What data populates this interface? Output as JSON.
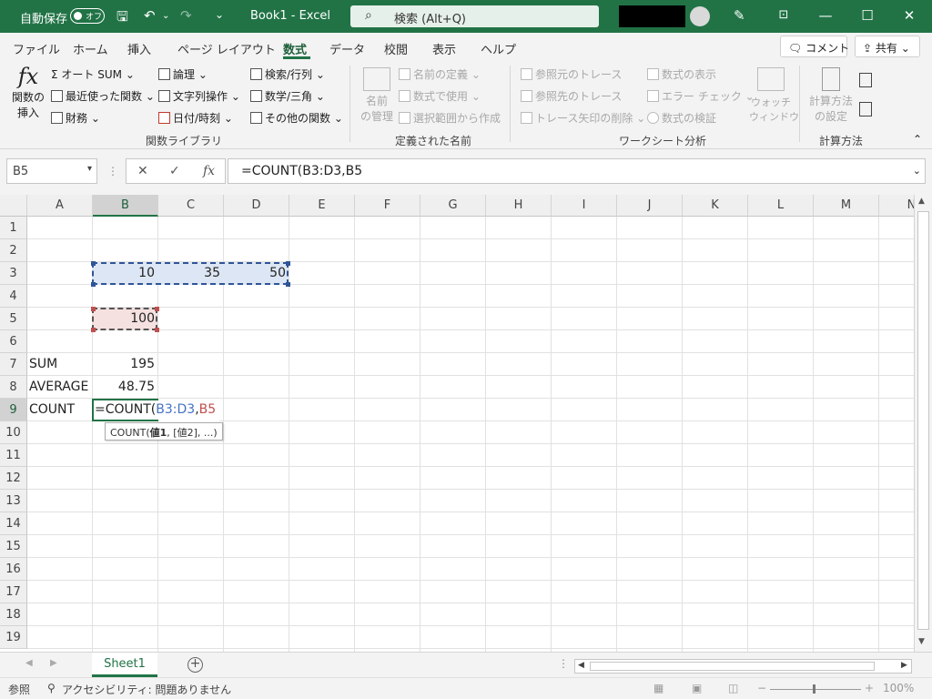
{
  "titlebar": {
    "autosave_label": "自動保存",
    "autosave_state": "オフ",
    "doc_title": "Book1  -  Excel",
    "search_placeholder": "検索 (Alt+Q)",
    "colors": {
      "brand": "#217346"
    }
  },
  "tabs": [
    "ファイル",
    "ホーム",
    "挿入",
    "ページ レイアウト",
    "数式",
    "データ",
    "校閲",
    "表示",
    "ヘルプ"
  ],
  "active_tab": "数式",
  "tab_buttons": {
    "comment": "コメント",
    "share": "共有"
  },
  "ribbon": {
    "insert_function": {
      "fx": "fx",
      "line1": "関数の",
      "line2": "挿入"
    },
    "library": {
      "col1": [
        "オート SUM",
        "最近使った関数",
        "財務"
      ],
      "col2": [
        "論理",
        "文字列操作",
        "日付/時刻"
      ],
      "col3": [
        "検索/行列",
        "数学/三角",
        "その他の関数"
      ],
      "group": "関数ライブラリ"
    },
    "names": {
      "manager_l1": "名前",
      "manager_l2": "の管理",
      "items": [
        "名前の定義",
        "数式で使用",
        "選択範囲から作成"
      ],
      "group": "定義された名前"
    },
    "audit": {
      "col1": [
        "参照元のトレース",
        "参照先のトレース",
        "トレース矢印の削除"
      ],
      "col2": [
        "数式の表示",
        "エラー チェック",
        "数式の検証"
      ],
      "watch_l1": "ウォッチ",
      "watch_l2": "ウィンドウ",
      "group": "ワークシート分析"
    },
    "calc": {
      "l1": "計算方法",
      "l2": "の設定",
      "group": "計算方法"
    }
  },
  "formula_bar": {
    "name_box": "B5",
    "cancel": "✕",
    "enter": "✓",
    "fx": "fx",
    "formula": "=COUNT(B3:D3,B5"
  },
  "columns": [
    "A",
    "B",
    "C",
    "D",
    "E",
    "F",
    "G",
    "H",
    "I",
    "J",
    "K",
    "L",
    "M",
    "N"
  ],
  "rows": [
    "1",
    "2",
    "3",
    "4",
    "5",
    "6",
    "7",
    "8",
    "9",
    "10",
    "11",
    "12",
    "13",
    "14",
    "15",
    "16",
    "17",
    "18",
    "19"
  ],
  "cells": {
    "B3": "10",
    "C3": "35",
    "D3": "50",
    "B5": "100",
    "A7": "SUM",
    "B7": "195",
    "A8": "AVERAGE",
    "B8": "48.75",
    "A9": "COUNT",
    "B9_prefix": "=COUNT(",
    "B9_ref1": "B3:D3",
    "B9_comma": ",",
    "B9_ref2": "B5"
  },
  "tooltip": {
    "fn": "COUNT(",
    "arg1": "値1",
    "rest": ", [値2], ...)"
  },
  "ref_colors": {
    "range1": "#4472c4",
    "range2": "#c0504d"
  },
  "sheet_tab": "Sheet1",
  "status": {
    "mode": "参照",
    "accessibility": "アクセシビリティ: 問題ありません",
    "zoom": "100%"
  }
}
